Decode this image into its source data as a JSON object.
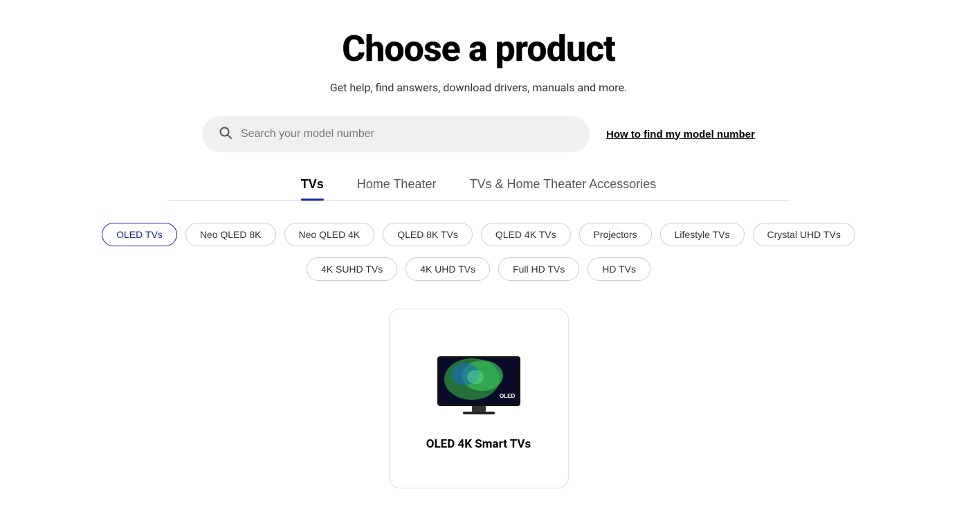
{
  "page": {
    "title": "Choose a product",
    "subtitle": "Get help, find answers, download drivers, manuals and more."
  },
  "search": {
    "placeholder": "Search your model number",
    "model_link": "How to find my model number"
  },
  "tabs": [
    {
      "id": "tvs",
      "label": "TVs",
      "active": true
    },
    {
      "id": "home-theater",
      "label": "Home Theater",
      "active": false
    },
    {
      "id": "accessories",
      "label": "TVs & Home Theater Accessories",
      "active": false
    }
  ],
  "filters_row1": [
    {
      "id": "oled-tvs",
      "label": "OLED TVs",
      "active": true
    },
    {
      "id": "neo-qled-8k",
      "label": "Neo QLED 8K",
      "active": false
    },
    {
      "id": "neo-qled-4k",
      "label": "Neo QLED 4K",
      "active": false
    },
    {
      "id": "qled-8k-tvs",
      "label": "QLED 8K TVs",
      "active": false
    },
    {
      "id": "qled-4k-tvs",
      "label": "QLED 4K TVs",
      "active": false
    },
    {
      "id": "projectors",
      "label": "Projectors",
      "active": false
    },
    {
      "id": "lifestyle-tvs",
      "label": "Lifestyle TVs",
      "active": false
    },
    {
      "id": "crystal-uhd-tvs",
      "label": "Crystal UHD TVs",
      "active": false
    }
  ],
  "filters_row2": [
    {
      "id": "4k-suhd-tvs",
      "label": "4K SUHD TVs",
      "active": false
    },
    {
      "id": "4k-uhd-tvs",
      "label": "4K UHD TVs",
      "active": false
    },
    {
      "id": "full-hd-tvs",
      "label": "Full HD TVs",
      "active": false
    },
    {
      "id": "hd-tvs",
      "label": "HD TVs",
      "active": false
    }
  ],
  "products": [
    {
      "id": "oled-4k-smart-tvs",
      "name": "OLED 4K Smart TVs"
    }
  ],
  "colors": {
    "accent": "#1428A0"
  }
}
